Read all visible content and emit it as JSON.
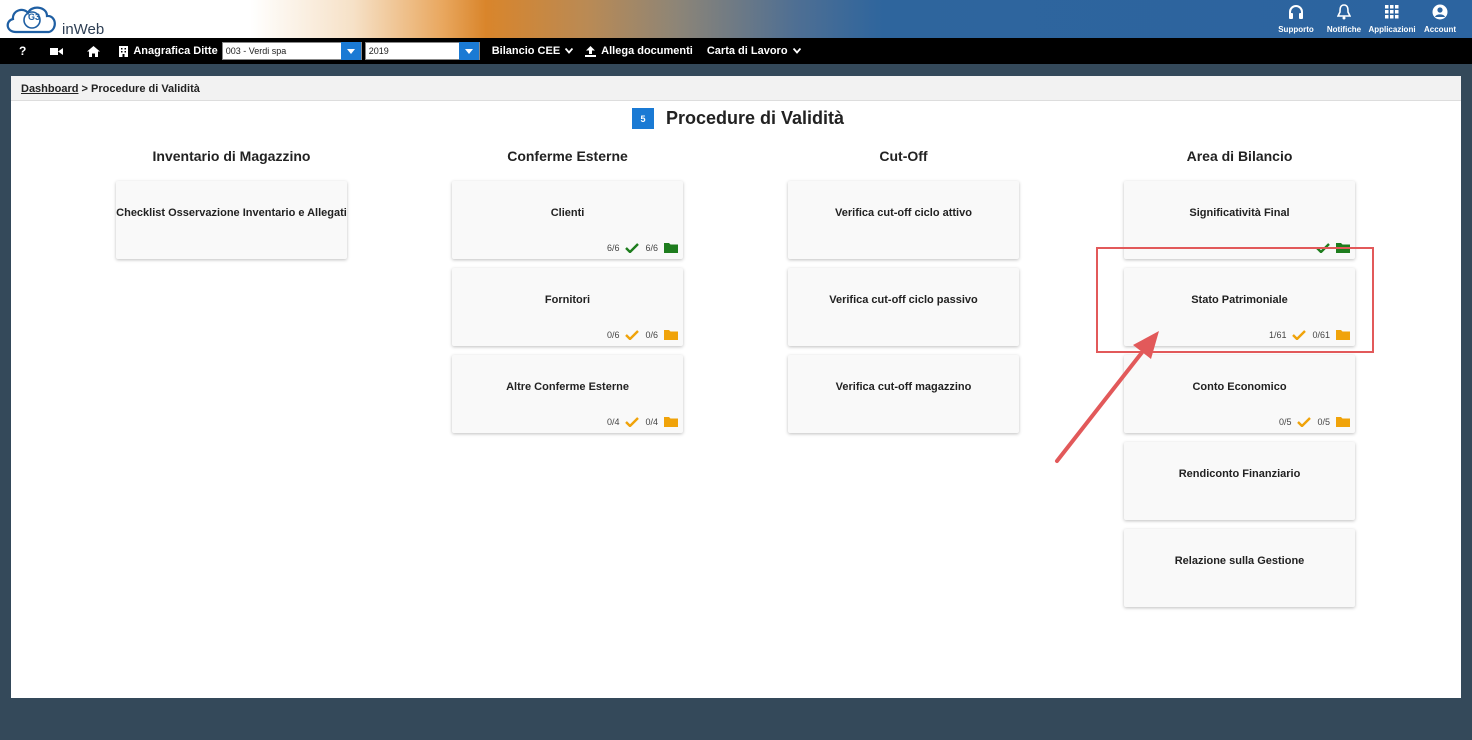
{
  "app": {
    "logo_text": "inWeb",
    "logo_mark": "G3",
    "top_icons": [
      {
        "name": "supporto",
        "label": "Supporto",
        "icon": "headset-icon"
      },
      {
        "name": "notifiche",
        "label": "Notifiche",
        "icon": "bell-icon"
      },
      {
        "name": "applicazioni",
        "label": "Applicazioni",
        "icon": "grid-icon"
      },
      {
        "name": "account",
        "label": "Account",
        "icon": "user-circle-icon"
      }
    ]
  },
  "menubar": {
    "help_icon": "?",
    "anagrafica_label": "Anagrafica Ditte",
    "company_select_value": "003 - Verdi spa",
    "year_select_value": "2019",
    "bilancio_label": "Bilancio CEE",
    "allega_label": "Allega documenti",
    "carta_label": "Carta di Lavoro"
  },
  "breadcrumb": {
    "home": "Dashboard",
    "separator": ">",
    "current": "Procedure di Validità"
  },
  "page": {
    "badge": "5",
    "title": "Procedure di Validità"
  },
  "columns": [
    {
      "title": "Inventario di Magazzino",
      "cards": [
        {
          "title": "Checklist Osservazione Inventario e Allegati"
        }
      ]
    },
    {
      "title": "Conferme Esterne",
      "cards": [
        {
          "title": "Clienti",
          "done": "6/6",
          "docs": "6/6",
          "status_color": "#1e7d1e"
        },
        {
          "title": "Fornitori",
          "done": "0/6",
          "docs": "0/6",
          "status_color": "#f0a30a"
        },
        {
          "title": "Altre Conferme Esterne",
          "done": "0/4",
          "docs": "0/4",
          "status_color": "#f0a30a"
        }
      ]
    },
    {
      "title": "Cut-Off",
      "cards": [
        {
          "title": "Verifica cut-off ciclo attivo"
        },
        {
          "title": "Verifica cut-off ciclo passivo"
        },
        {
          "title": "Verifica cut-off magazzino"
        }
      ]
    },
    {
      "title": "Area di Bilancio",
      "cards": [
        {
          "title": "Significatività Final",
          "status_color": "#1e7d1e"
        },
        {
          "title": "Stato Patrimoniale",
          "done": "1/61",
          "docs": "0/61",
          "status_color": "#f0a30a"
        },
        {
          "title": "Conto Economico",
          "done": "0/5",
          "docs": "0/5",
          "status_color": "#f0a30a"
        },
        {
          "title": "Rendiconto Finanziario"
        },
        {
          "title": "Relazione sulla Gestione"
        }
      ]
    }
  ],
  "colors": {
    "topbar_blue": "#2c64a0",
    "accent_blue": "#1a7ad4",
    "page_bg": "#34495a",
    "check_green": "#1e7d1e",
    "check_orange": "#f0a30a",
    "annotation_red": "#e2595a"
  }
}
